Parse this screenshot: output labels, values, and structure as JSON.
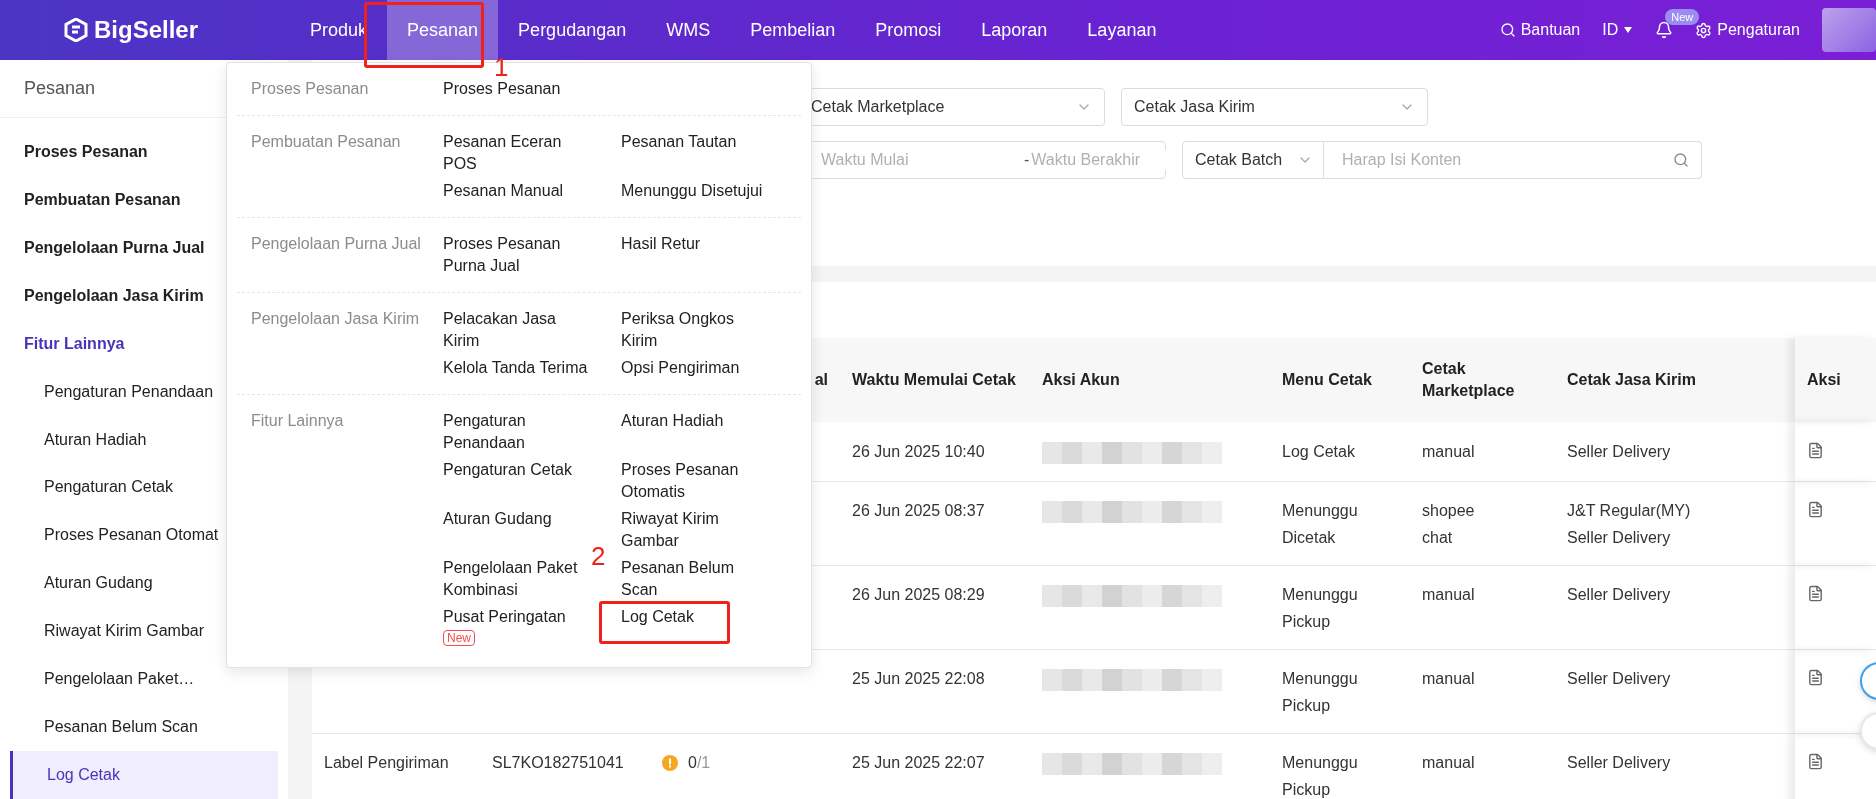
{
  "header": {
    "logo": "BigSeller",
    "nav": [
      {
        "label": "Produk",
        "selected": false
      },
      {
        "label": "Pesanan",
        "selected": true
      },
      {
        "label": "Pergudangan",
        "selected": false
      },
      {
        "label": "WMS",
        "selected": false
      },
      {
        "label": "Pembelian",
        "selected": false
      },
      {
        "label": "Promosi",
        "selected": false
      },
      {
        "label": "Laporan",
        "selected": false
      },
      {
        "label": "Layanan",
        "selected": false
      }
    ],
    "help": "Bantuan",
    "language": "ID",
    "notification_badge": "New",
    "settings": "Pengaturan"
  },
  "sidebar": {
    "title": "Pesanan",
    "items": [
      {
        "label": "Proses Pesanan"
      },
      {
        "label": "Pembuatan Pesanan"
      },
      {
        "label": "Pengelolaan Purna Jual"
      },
      {
        "label": "Pengelolaan Jasa Kirim"
      },
      {
        "label": "Fitur Lainnya",
        "children": [
          {
            "label": "Pengaturan Penandaan",
            "selected": false
          },
          {
            "label": "Aturan Hadiah",
            "selected": false
          },
          {
            "label": "Pengaturan Cetak",
            "selected": false
          },
          {
            "label": "Proses Pesanan Otomat",
            "selected": false
          },
          {
            "label": "Aturan Gudang",
            "selected": false
          },
          {
            "label": "Riwayat Kirim Gambar",
            "selected": false
          },
          {
            "label": "Pengelolaan Paket…",
            "selected": false
          },
          {
            "label": "Pesanan Belum Scan",
            "selected": false
          },
          {
            "label": "Log Cetak",
            "selected": true
          }
        ]
      }
    ]
  },
  "mega_menu": {
    "groups": [
      {
        "label": "Proses Pesanan",
        "links": [
          {
            "label": "Proses Pesanan"
          }
        ]
      },
      {
        "label": "Pembuatan Pesanan",
        "links": [
          {
            "label": "Pesanan Eceran POS"
          },
          {
            "label": "Pesanan Tautan"
          },
          {
            "label": "Pesanan Manual"
          },
          {
            "label": "Menunggu Disetujui"
          }
        ]
      },
      {
        "label": "Pengelolaan Purna Jual",
        "links": [
          {
            "label": "Proses Pesanan Purna Jual"
          },
          {
            "label": "Hasil Retur"
          }
        ]
      },
      {
        "label": "Pengelolaan Jasa Kirim",
        "links": [
          {
            "label": "Pelacakan Jasa Kirim"
          },
          {
            "label": "Periksa Ongkos Kirim"
          },
          {
            "label": "Kelola Tanda Terima"
          },
          {
            "label": "Opsi Pengiriman"
          }
        ]
      },
      {
        "label": "Fitur Lainnya",
        "links": [
          {
            "label": "Pengaturan Penandaan"
          },
          {
            "label": "Aturan Hadiah"
          },
          {
            "label": "Pengaturan Cetak"
          },
          {
            "label": "Proses Pesanan Otomatis"
          },
          {
            "label": "Aturan Gudang"
          },
          {
            "label": "Riwayat Kirim Gambar"
          },
          {
            "label": "Pengelolaan Paket Kombinasi"
          },
          {
            "label": "Pesanan Belum Scan"
          },
          {
            "label": "Pusat Peringatan",
            "badge": "New"
          },
          {
            "label": "Log Cetak"
          }
        ]
      }
    ]
  },
  "annotations": [
    {
      "label": "1"
    },
    {
      "label": "2"
    }
  ],
  "filters": {
    "selects": [
      {
        "label": "Cetak Marketplace"
      },
      {
        "label": "Cetak Jasa Kirim"
      }
    ],
    "date_range": {
      "start_placeholder": "Waktu Mulai",
      "separator": "-",
      "end_placeholder": "Waktu Berakhir"
    },
    "search_type": "Cetak Batch",
    "search": {
      "placeholder": "Harap Isi Konten"
    }
  },
  "table": {
    "columns": [
      "al",
      "Waktu Memulai Cetak",
      "Aksi Akun",
      "Menu Cetak",
      "Cetak Marketplace",
      "Cetak Jasa Kirim",
      "Aksi"
    ],
    "rows": [
      {
        "time": "26 Jun 2025 10:40",
        "menu": "Log Cetak",
        "marketplace": "manual",
        "courier": "Seller Delivery"
      },
      {
        "time": "26 Jun 2025 08:37",
        "menu": "Menunggu Dicetak",
        "marketplace": "shopee chat",
        "courier": "J&T Regular(MY) Seller Delivery"
      },
      {
        "time": "26 Jun 2025 08:29",
        "menu": "Menunggu Pickup",
        "marketplace": "manual",
        "courier": "Seller Delivery"
      },
      {
        "time": "25 Jun 2025 22:08",
        "menu": "Menunggu Pickup",
        "marketplace": "manual",
        "courier": "Seller Delivery"
      },
      {
        "type": "Label Pengiriman",
        "batch": "SL7KO182751041",
        "count": {
          "printed": "0",
          "total": "/1"
        },
        "time": "25 Jun 2025 22:07",
        "menu": "Menunggu Pickup",
        "marketplace": "manual",
        "courier": "Seller Delivery"
      }
    ]
  }
}
